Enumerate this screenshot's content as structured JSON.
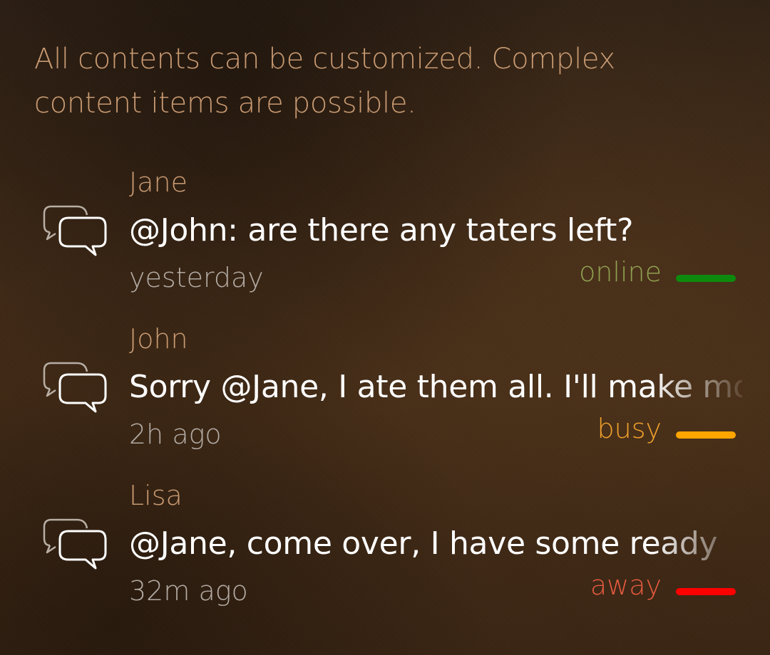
{
  "intro_text": "All contents can be customized. Complex content items are possible.",
  "colors": {
    "intro": "#c89a72",
    "author": "#c89a72",
    "message": "#ffffff",
    "time": "#b3aba4"
  },
  "messages": [
    {
      "author": "Jane",
      "text": "@John: are there any taters left?",
      "time": "yesterday",
      "status": "online",
      "status_label_color": "#8fa050",
      "status_bar_color": "#0d8a0d",
      "icon": "chat-bubbles-icon"
    },
    {
      "author": "John",
      "text": "Sorry @Jane, I ate them all. I'll make more",
      "time": "2h ago",
      "status": "busy",
      "status_label_color": "#f0a02c",
      "status_bar_color": "#ffa500",
      "icon": "chat-bubbles-icon"
    },
    {
      "author": "Lisa",
      "text": "@Jane, come over, I have some ready",
      "time": "32m ago",
      "status": "away",
      "status_label_color": "#e55a3f",
      "status_bar_color": "#ff0000",
      "icon": "chat-bubbles-icon"
    }
  ]
}
